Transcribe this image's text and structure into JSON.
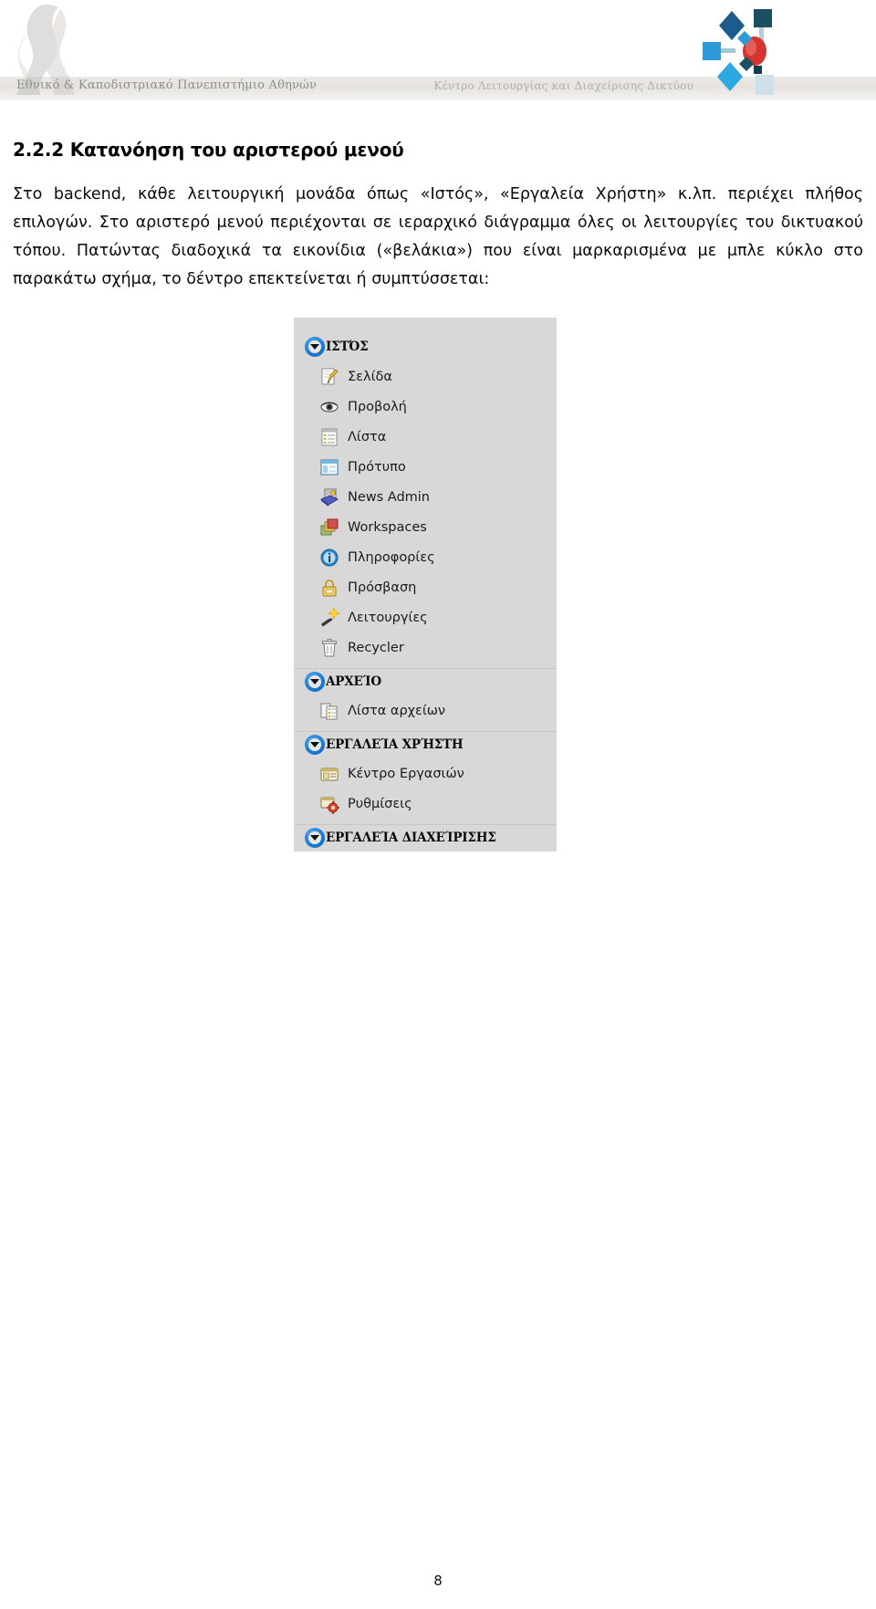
{
  "header": {
    "university_caption": "Εθνικό & Καποδιστριακό Πανεπιστήμιο Αθηνών",
    "noc_caption": "Κέντρο Λειτουργίας και Διαχείρισης Δικτύου",
    "seal_icon": "athena-seal-watermark-icon",
    "noc_logo_icon": "network-nodes-logo-icon"
  },
  "content": {
    "section_number": "2.2.2",
    "section_title": "2.2.2 Κατανόηση του αριστερού μενού",
    "paragraph": "Στο backend, κάθε λειτουργική μονάδα όπως «Ιστός», «Εργαλεία Χρήστη» κ.λπ. περιέχει πλήθος επιλογών. Στο αριστερό μενού περιέχονται σε ιεραρχικό διάγραμμα όλες οι λειτουργίες του δικτυακού τόπου. Πατώντας διαδοχικά τα εικονίδια («βελάκια») που είναι μαρκαρισμένα με μπλε κύκλο στο παρακάτω σχήμα, το δέντρο επεκτείνεται ή συμπτύσσεται:"
  },
  "figure": {
    "name": "typo3-backend-left-menu-screenshot",
    "background_color": "#d8d8d8",
    "toggle_highlight_color": "#1878cf",
    "groups": [
      {
        "label": "ΙΣΤΌΣ",
        "toggle_icon": "collapse-triangle-icon",
        "items": [
          {
            "label": "Σελίδα",
            "icon": "page-edit-icon"
          },
          {
            "label": "Προβολή",
            "icon": "eye-view-icon"
          },
          {
            "label": "Λίστα",
            "icon": "list-icon"
          },
          {
            "label": "Πρότυπο",
            "icon": "template-icon"
          },
          {
            "label": "News Admin",
            "icon": "news-admin-icon"
          },
          {
            "label": "Workspaces",
            "icon": "workspaces-icon"
          },
          {
            "label": "Πληροφορίες",
            "icon": "info-icon"
          },
          {
            "label": "Πρόσβαση",
            "icon": "lock-access-icon"
          },
          {
            "label": "Λειτουργίες",
            "icon": "magic-wand-functions-icon"
          },
          {
            "label": "Recycler",
            "icon": "trash-recycler-icon"
          }
        ]
      },
      {
        "label": "ΑΡΧΕΊΟ",
        "toggle_icon": "collapse-triangle-icon",
        "items": [
          {
            "label": "Λίστα αρχείων",
            "icon": "filelist-icon"
          }
        ]
      },
      {
        "label": "ΕΡΓΑΛΕΊΑ ΧΡΉΣΤΗ",
        "toggle_icon": "collapse-triangle-icon",
        "items": [
          {
            "label": "Κέντρο Εργασιών",
            "icon": "task-center-icon"
          },
          {
            "label": "Ρυθμίσεις",
            "icon": "user-settings-icon"
          }
        ]
      },
      {
        "label": "ΕΡΓΑΛΕΊΑ ΔΙΑΧΕΊΡΙΣΗΣ",
        "toggle_icon": "collapse-triangle-icon",
        "items": []
      }
    ]
  },
  "footer": {
    "page_number": "8"
  }
}
